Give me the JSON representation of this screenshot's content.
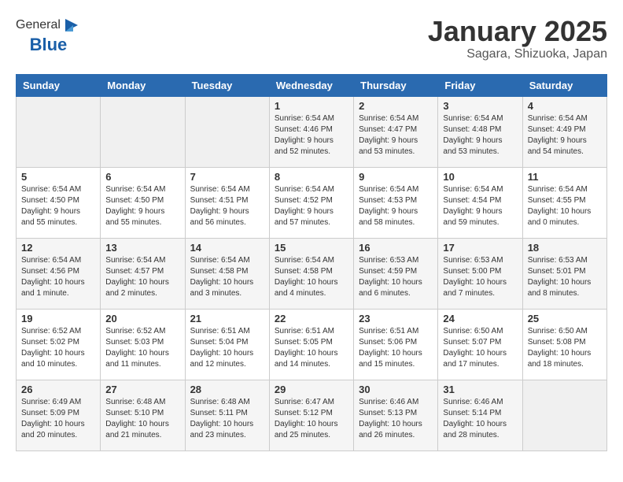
{
  "header": {
    "logo_general": "General",
    "logo_blue": "Blue",
    "month_title": "January 2025",
    "location": "Sagara, Shizuoka, Japan"
  },
  "weekdays": [
    "Sunday",
    "Monday",
    "Tuesday",
    "Wednesday",
    "Thursday",
    "Friday",
    "Saturday"
  ],
  "weeks": [
    [
      {
        "day": "",
        "info": ""
      },
      {
        "day": "",
        "info": ""
      },
      {
        "day": "",
        "info": ""
      },
      {
        "day": "1",
        "info": "Sunrise: 6:54 AM\nSunset: 4:46 PM\nDaylight: 9 hours\nand 52 minutes."
      },
      {
        "day": "2",
        "info": "Sunrise: 6:54 AM\nSunset: 4:47 PM\nDaylight: 9 hours\nand 53 minutes."
      },
      {
        "day": "3",
        "info": "Sunrise: 6:54 AM\nSunset: 4:48 PM\nDaylight: 9 hours\nand 53 minutes."
      },
      {
        "day": "4",
        "info": "Sunrise: 6:54 AM\nSunset: 4:49 PM\nDaylight: 9 hours\nand 54 minutes."
      }
    ],
    [
      {
        "day": "5",
        "info": "Sunrise: 6:54 AM\nSunset: 4:50 PM\nDaylight: 9 hours\nand 55 minutes."
      },
      {
        "day": "6",
        "info": "Sunrise: 6:54 AM\nSunset: 4:50 PM\nDaylight: 9 hours\nand 55 minutes."
      },
      {
        "day": "7",
        "info": "Sunrise: 6:54 AM\nSunset: 4:51 PM\nDaylight: 9 hours\nand 56 minutes."
      },
      {
        "day": "8",
        "info": "Sunrise: 6:54 AM\nSunset: 4:52 PM\nDaylight: 9 hours\nand 57 minutes."
      },
      {
        "day": "9",
        "info": "Sunrise: 6:54 AM\nSunset: 4:53 PM\nDaylight: 9 hours\nand 58 minutes."
      },
      {
        "day": "10",
        "info": "Sunrise: 6:54 AM\nSunset: 4:54 PM\nDaylight: 9 hours\nand 59 minutes."
      },
      {
        "day": "11",
        "info": "Sunrise: 6:54 AM\nSunset: 4:55 PM\nDaylight: 10 hours\nand 0 minutes."
      }
    ],
    [
      {
        "day": "12",
        "info": "Sunrise: 6:54 AM\nSunset: 4:56 PM\nDaylight: 10 hours\nand 1 minute."
      },
      {
        "day": "13",
        "info": "Sunrise: 6:54 AM\nSunset: 4:57 PM\nDaylight: 10 hours\nand 2 minutes."
      },
      {
        "day": "14",
        "info": "Sunrise: 6:54 AM\nSunset: 4:58 PM\nDaylight: 10 hours\nand 3 minutes."
      },
      {
        "day": "15",
        "info": "Sunrise: 6:54 AM\nSunset: 4:58 PM\nDaylight: 10 hours\nand 4 minutes."
      },
      {
        "day": "16",
        "info": "Sunrise: 6:53 AM\nSunset: 4:59 PM\nDaylight: 10 hours\nand 6 minutes."
      },
      {
        "day": "17",
        "info": "Sunrise: 6:53 AM\nSunset: 5:00 PM\nDaylight: 10 hours\nand 7 minutes."
      },
      {
        "day": "18",
        "info": "Sunrise: 6:53 AM\nSunset: 5:01 PM\nDaylight: 10 hours\nand 8 minutes."
      }
    ],
    [
      {
        "day": "19",
        "info": "Sunrise: 6:52 AM\nSunset: 5:02 PM\nDaylight: 10 hours\nand 10 minutes."
      },
      {
        "day": "20",
        "info": "Sunrise: 6:52 AM\nSunset: 5:03 PM\nDaylight: 10 hours\nand 11 minutes."
      },
      {
        "day": "21",
        "info": "Sunrise: 6:51 AM\nSunset: 5:04 PM\nDaylight: 10 hours\nand 12 minutes."
      },
      {
        "day": "22",
        "info": "Sunrise: 6:51 AM\nSunset: 5:05 PM\nDaylight: 10 hours\nand 14 minutes."
      },
      {
        "day": "23",
        "info": "Sunrise: 6:51 AM\nSunset: 5:06 PM\nDaylight: 10 hours\nand 15 minutes."
      },
      {
        "day": "24",
        "info": "Sunrise: 6:50 AM\nSunset: 5:07 PM\nDaylight: 10 hours\nand 17 minutes."
      },
      {
        "day": "25",
        "info": "Sunrise: 6:50 AM\nSunset: 5:08 PM\nDaylight: 10 hours\nand 18 minutes."
      }
    ],
    [
      {
        "day": "26",
        "info": "Sunrise: 6:49 AM\nSunset: 5:09 PM\nDaylight: 10 hours\nand 20 minutes."
      },
      {
        "day": "27",
        "info": "Sunrise: 6:48 AM\nSunset: 5:10 PM\nDaylight: 10 hours\nand 21 minutes."
      },
      {
        "day": "28",
        "info": "Sunrise: 6:48 AM\nSunset: 5:11 PM\nDaylight: 10 hours\nand 23 minutes."
      },
      {
        "day": "29",
        "info": "Sunrise: 6:47 AM\nSunset: 5:12 PM\nDaylight: 10 hours\nand 25 minutes."
      },
      {
        "day": "30",
        "info": "Sunrise: 6:46 AM\nSunset: 5:13 PM\nDaylight: 10 hours\nand 26 minutes."
      },
      {
        "day": "31",
        "info": "Sunrise: 6:46 AM\nSunset: 5:14 PM\nDaylight: 10 hours\nand 28 minutes."
      },
      {
        "day": "",
        "info": ""
      }
    ]
  ]
}
